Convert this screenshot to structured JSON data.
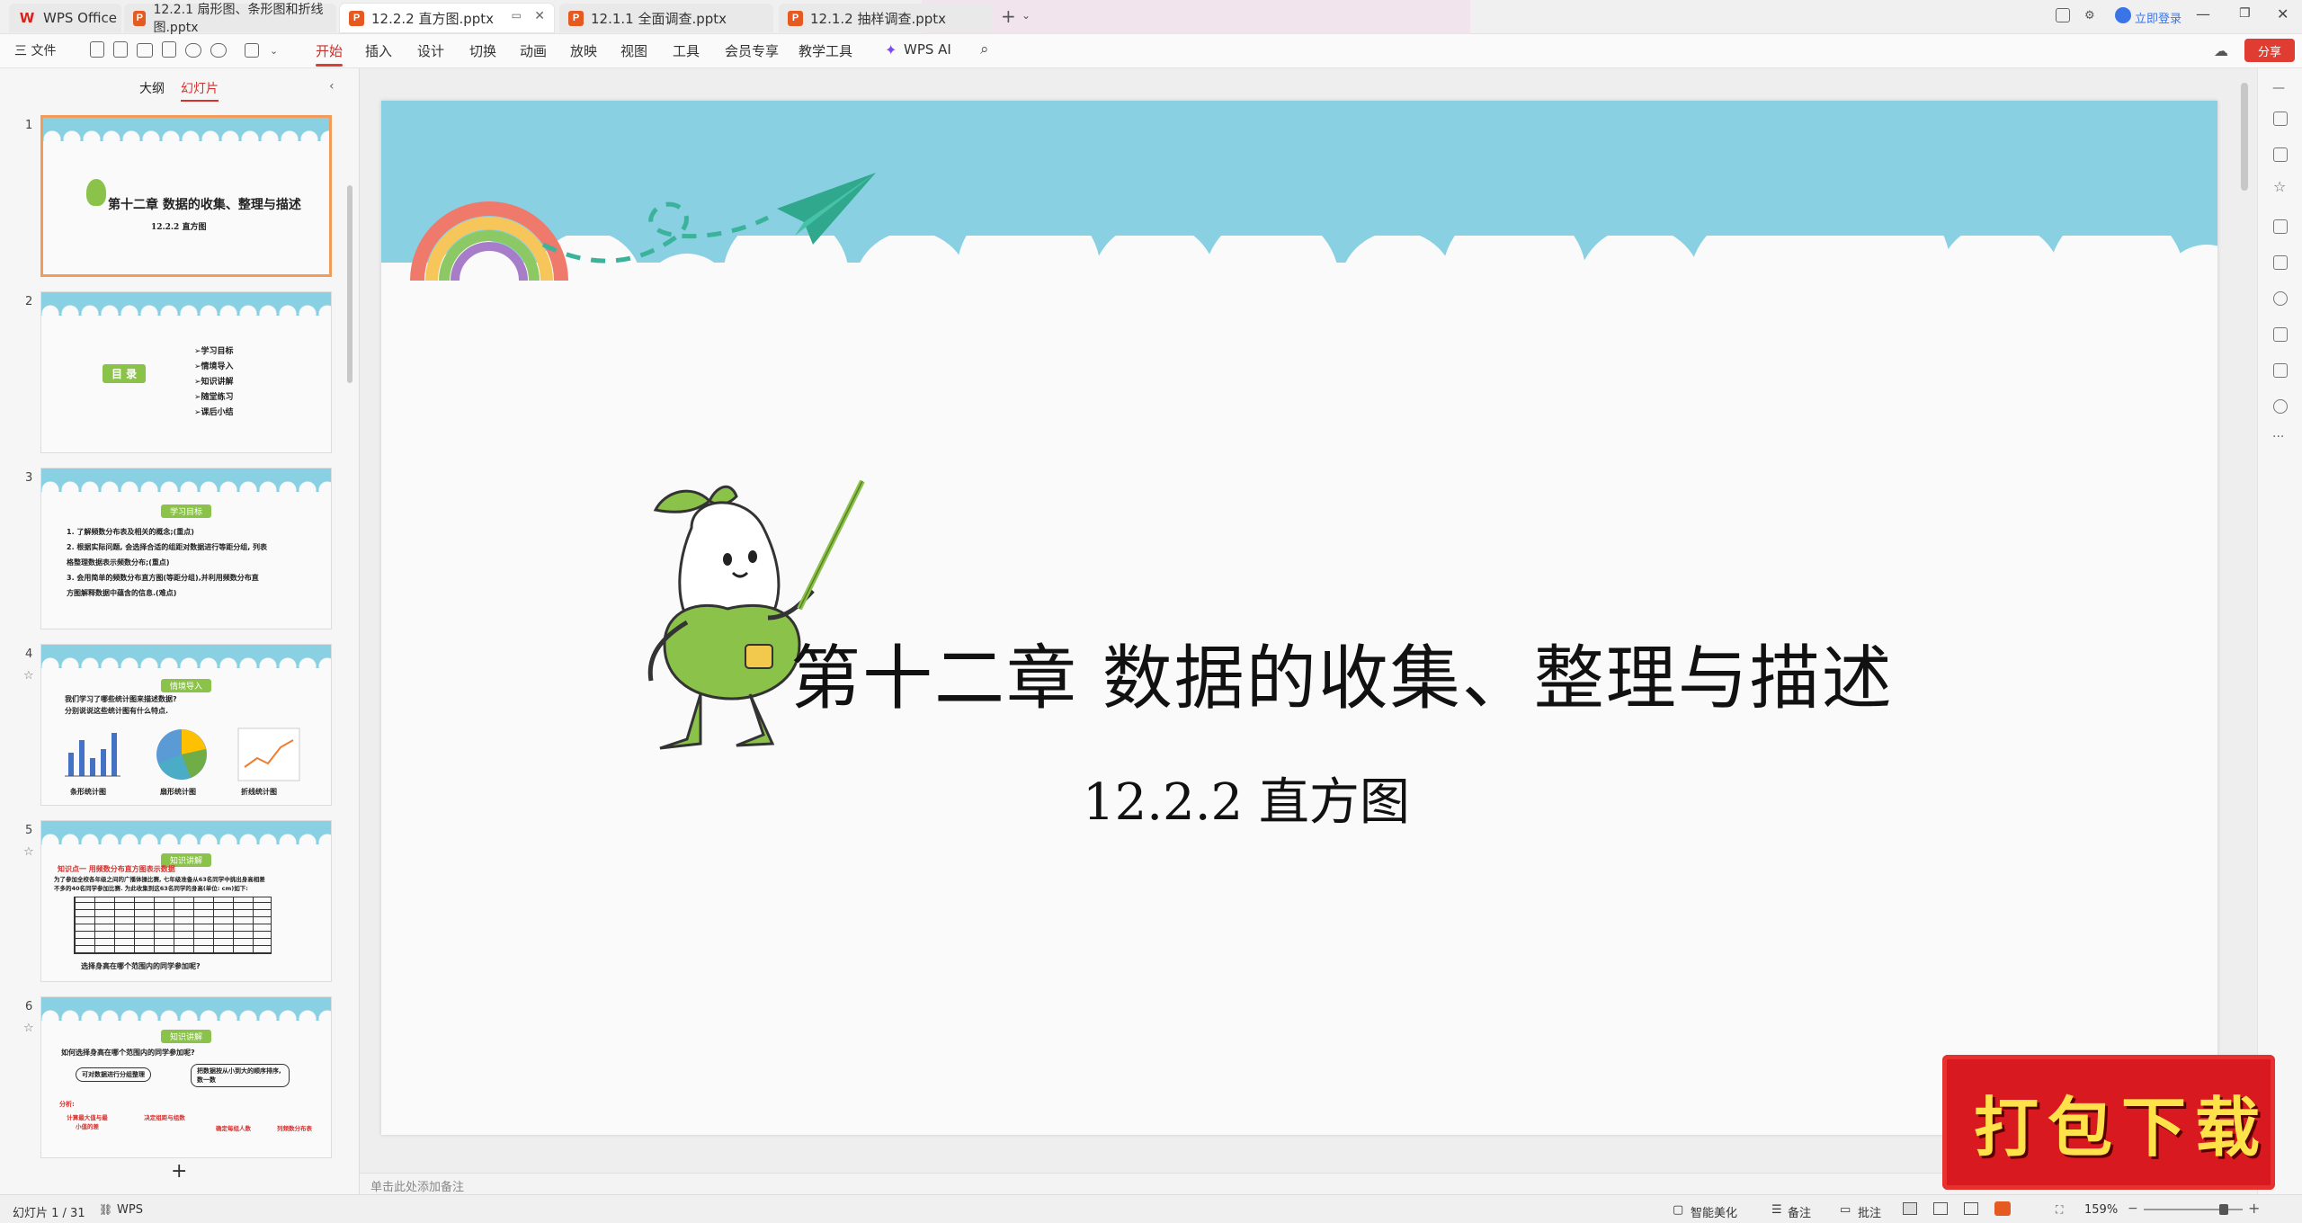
{
  "tabs": [
    {
      "label": "WPS Office",
      "type": "home"
    },
    {
      "label": "12.2.1 扇形图、条形图和折线图.pptx",
      "type": "ppt"
    },
    {
      "label": "12.2.2 直方图.pptx",
      "type": "ppt",
      "active": true
    },
    {
      "label": "12.1.1 全面调查.pptx",
      "type": "ppt"
    },
    {
      "label": "12.1.2 抽样调查.pptx",
      "type": "ppt"
    }
  ],
  "titlebar": {
    "login_label": "立即登录",
    "share_label": "分享"
  },
  "ribbon": {
    "file_label": "三 文件",
    "menu": [
      "开始",
      "插入",
      "设计",
      "切换",
      "动画",
      "放映",
      "视图",
      "工具",
      "会员专享",
      "教学工具"
    ],
    "ai_label": "WPS AI"
  },
  "left_panel": {
    "tab_outline": "大纲",
    "tab_slides": "幻灯片",
    "add_label": "+"
  },
  "thumbs": [
    {
      "num": "1",
      "title": "第十二章 数据的收集、整理与描述",
      "sub": "12.2.2 直方图"
    },
    {
      "num": "2",
      "banner": "目 录",
      "items": [
        "➢学习目标",
        "➢情境导入",
        "➢知识讲解",
        "➢随堂练习",
        "➢课后小结"
      ]
    },
    {
      "num": "3",
      "banner": "学习目标",
      "lines": [
        "1. 了解频数分布表及相关的概念;(重点)",
        "2. 根据实际问题, 会选择合适的组距对数据进行等距分组, 列表",
        "格整理数据表示频数分布;(重点)",
        "3. 会用简单的频数分布直方图(等距分组),并利用频数分布直",
        "方图解释数据中蕴含的信息.(难点)"
      ]
    },
    {
      "num": "4",
      "banner": "情境导入",
      "lines": [
        "我们学习了哪些统计图来描述数据?",
        "分别说说这些统计图有什么特点."
      ],
      "charts": [
        "条形统计图",
        "扇形统计图",
        "折线统计图"
      ]
    },
    {
      "num": "5",
      "banner": "知识讲解",
      "heading": "知识点一 用频数分布直方图表示数据",
      "lines": [
        "为了参加全校各年级之间的广播体操比赛, 七年级准备从63名同学中挑出身高相差",
        "不多的40名同学参加比赛. 为此收集到这63名同学的身高(单位: cm)如下:"
      ],
      "footer": "选择身高在哪个范围内的同学参加呢?"
    },
    {
      "num": "6",
      "banner": "知识讲解",
      "lines": [
        "如何选择身高在哪个范围内的同学参加呢?"
      ],
      "boxes": [
        "可对数据进行分组整理",
        "把数据按从小到大的顺序排序, 数一数"
      ],
      "flow": [
        "分析:",
        "计算最大值与最小值的差",
        "决定组距与组数",
        "确定每组人数",
        "列频数分布表"
      ]
    }
  ],
  "slide": {
    "title": "第十二章  数据的收集、整理与描述",
    "subtitle": "12.2.2 直方图"
  },
  "notes_placeholder": "单击此处添加备注",
  "status": {
    "slide_info": "幻灯片 1 / 31",
    "wps_label": "WPS",
    "beautify": "智能美化",
    "notes": "备注",
    "comments": "批注",
    "zoom": "159%"
  },
  "promo_text": "打包下载",
  "colors": {
    "accent": "#e03c31",
    "sky": "#89d0e2",
    "green": "#8bc34a"
  }
}
